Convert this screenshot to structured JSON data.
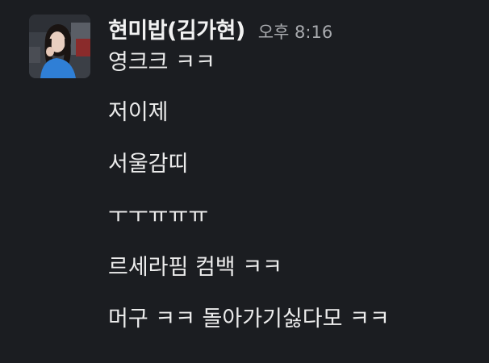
{
  "message": {
    "sender_name": "현미밥(김가현)",
    "timestamp": "오후 8:16",
    "avatar_icon": "profile-photo-avatar",
    "lines": [
      "영크크 ㅋㅋ",
      "저이제",
      "서울감띠",
      "ㅜㅜㅠㅠㅠ",
      "르세라핌 컴백 ㅋㅋ",
      "머구 ㅋㅋ 돌아가기싫다모 ㅋㅋ"
    ]
  },
  "colors": {
    "background": "#1b1d21",
    "text": "#ececec",
    "timestamp": "#a9abaf"
  }
}
